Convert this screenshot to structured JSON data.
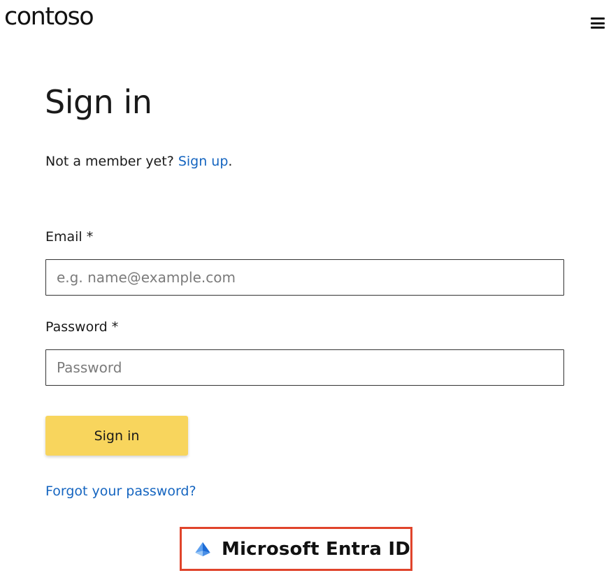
{
  "header": {
    "logo_text": "contoso",
    "menu_icon": "hamburger-menu-icon"
  },
  "signin": {
    "title": "Sign in",
    "not_member_text": "Not a member yet? ",
    "signup_link": "Sign up",
    "signup_suffix": ".",
    "email_label": "Email *",
    "email_placeholder": "e.g. name@example.com",
    "email_value": "",
    "password_label": "Password *",
    "password_placeholder": "Password",
    "password_value": "",
    "submit_label": "Sign in",
    "forgot_link": "Forgot your password?"
  },
  "provider_badge": {
    "label": "Microsoft Entra ID",
    "icon": "microsoft-entra-pyramid-icon",
    "border_color": "#e0442b"
  },
  "colors": {
    "link": "#1565c0",
    "button": "#f8d55d",
    "text": "#1a1a1a"
  }
}
